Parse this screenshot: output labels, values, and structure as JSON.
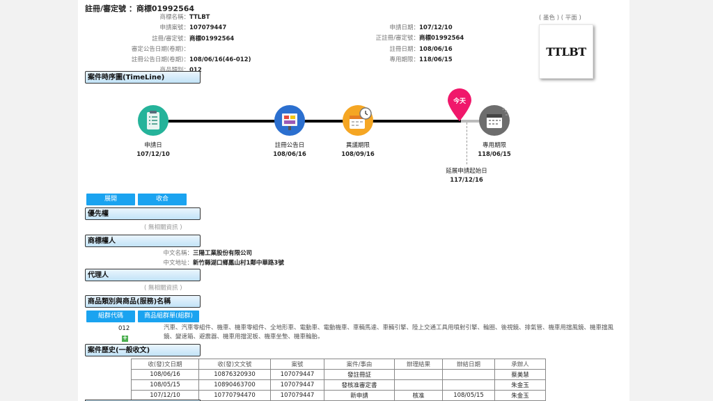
{
  "header": {
    "reg_label": "註冊/審定號 ：",
    "reg_value": "商標01992564"
  },
  "info_left": [
    {
      "label": "商標名稱：",
      "value": "TTLBT"
    },
    {
      "label": "申請案號：",
      "value": "107079447"
    },
    {
      "label": "註冊/審定號：",
      "value": "商標01992564"
    },
    {
      "label": "審定公告日期(卷期)：",
      "value": ""
    },
    {
      "label": "註冊公告日期(卷期)：",
      "value": "108/06/16(46-012)"
    },
    {
      "label": "商品類別：",
      "value": "012"
    }
  ],
  "info_right": [
    {
      "label": "申請日期：",
      "value": "107/12/10"
    },
    {
      "label": "正註冊/審定號：",
      "value": "商標01992564"
    },
    {
      "label": "註冊日期：",
      "value": "108/06/16"
    },
    {
      "label": "專用期限：",
      "value": "118/06/15"
    }
  ],
  "logo": {
    "caption": "( 墨色 ) ( 平面 )",
    "text": "TTLBT"
  },
  "sections": {
    "timeline": "案件時序圖(TimeLine)",
    "priority": "優先權",
    "owner": "商標權人",
    "agent": "代理人",
    "goods": "商品類別與商品(服務)名稱",
    "history": "案件歷史(一般收文)"
  },
  "buttons": {
    "expand": "展開",
    "collapse": "收合",
    "group_code": "組群代碼",
    "group_list": "商品組群單(組群)"
  },
  "no_data": "( 無相關資訊 )",
  "timeline": {
    "today": "今天",
    "events": [
      {
        "label": "申請日",
        "date": "107/12/10"
      },
      {
        "label": "註冊公告日",
        "date": "108/06/16"
      },
      {
        "label": "異議期限",
        "date": "108/09/16"
      },
      {
        "label": "專用期限",
        "date": "118/06/15"
      }
    ],
    "renewal": {
      "label": "延展申請起始日",
      "date": "117/12/16"
    }
  },
  "owner": {
    "name_label": "中文名稱：",
    "name": "三陽工業股份有限公司",
    "addr_label": "中文地址：",
    "addr": "新竹縣湖口鄉鳳山村1鄰中華路3號"
  },
  "goods": {
    "code": "012",
    "plus": "+",
    "text": "汽車、汽車零組件、機車、機車零組件、全地形車、電動車、電動機車、車輛馬達、車輛引擎、陸上交通工具用噴射引擎、輪圈、後視鏡、排氣管、機車用擋風鏡、機車擋風鏡、變速箱、避震器、機車用擋泥板、機車坐墊、機車輪胎。"
  },
  "history": {
    "headers": [
      "收(發)文日期",
      "收(發)文文號",
      "案號",
      "案件/事由",
      "辦理結果",
      "辦結日期",
      "承辦人"
    ],
    "rows": [
      [
        "108/06/16",
        "10876320930",
        "107079447",
        "發註冊証",
        "",
        "",
        "蔡美慧"
      ],
      [
        "108/05/15",
        "10890463700",
        "107079447",
        "發核准審定書",
        "",
        "",
        "朱金玉"
      ],
      [
        "107/12/10",
        "10770794470",
        "107079447",
        "新申請",
        "核准",
        "108/05/15",
        "朱金玉"
      ]
    ]
  }
}
